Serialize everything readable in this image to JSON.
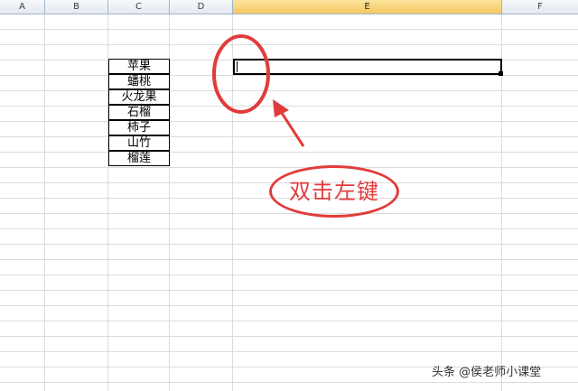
{
  "columns": [
    "A",
    "B",
    "C",
    "D",
    "E",
    "F"
  ],
  "selected_column": "E",
  "fruits": [
    "苹果",
    "蟠桃",
    "火龙果",
    "石榴",
    "柿子",
    "山竹",
    "榴莲"
  ],
  "annotation": {
    "text": "双击左键",
    "color": "#e23b3b"
  },
  "watermark": "头条 @侯老师小课堂",
  "colors": {
    "header_selected": "#f6c760",
    "grid": "#dadcdd",
    "header_border": "#9eb6ce"
  }
}
